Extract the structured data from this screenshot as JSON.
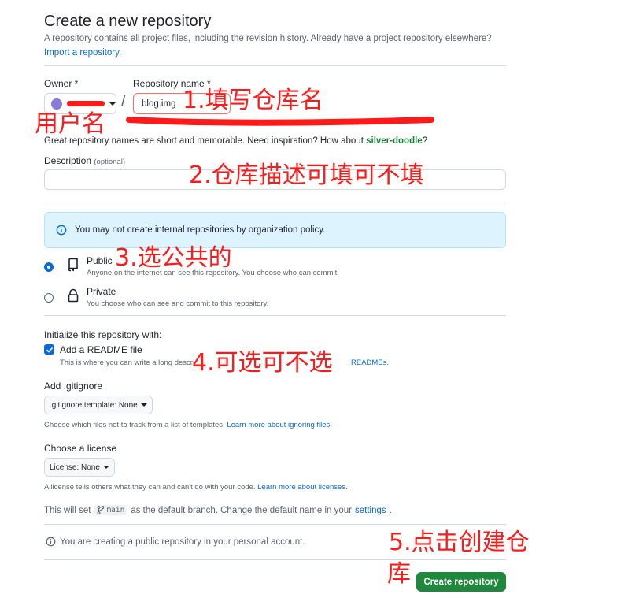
{
  "header": {
    "title": "Create a new repository",
    "description": "A repository contains all project files, including the revision history. Already have a project repository elsewhere?",
    "import_link": "Import a repository."
  },
  "owner": {
    "label": "Owner *"
  },
  "repo_name": {
    "label": "Repository name *",
    "value": "blog.img",
    "separator": "/"
  },
  "hint": {
    "prefix": "Great repository names are short and memorable. Need inspiration? How about ",
    "suggestion": "silver-doodle",
    "suffix": "?"
  },
  "description_field": {
    "label": "Description",
    "optional": "(optional)",
    "value": ""
  },
  "notice": {
    "text": "You may not create internal repositories by organization policy."
  },
  "visibility": {
    "public": {
      "label": "Public",
      "desc": "Anyone on the internet can see this repository. You choose who can commit.",
      "selected": true
    },
    "private": {
      "label": "Private",
      "desc": "You choose who can see and commit to this repository.",
      "selected": false
    }
  },
  "init": {
    "heading": "Initialize this repository with:",
    "readme_label": "Add a README file",
    "readme_checked": true,
    "readme_desc_prefix": "This is where you can write a long descri",
    "readme_desc_suffix": "READMEs."
  },
  "gitignore": {
    "heading": "Add .gitignore",
    "select": ".gitignore template: None",
    "desc": "Choose which files not to track from a list of templates.",
    "link": "Learn more about ignoring files."
  },
  "license": {
    "heading": "Choose a license",
    "select": "License: None",
    "desc": "A license tells others what they can and can't do with your code.",
    "link": "Learn more about licenses."
  },
  "branch": {
    "prefix": "This will set",
    "branch": "main",
    "middle": "as the default branch. Change the default name in your",
    "link": "settings",
    "suffix": "."
  },
  "public_notice": "You are creating a public repository in your personal account.",
  "submit": "Create repository",
  "annotations": {
    "a1": "1.填写仓库名",
    "owner": "用户名",
    "a2": "2.仓库描述可填可不填",
    "a3": "3.选公共的",
    "a4": "4.可选可不选",
    "a5_line1": "5.点击创建仓",
    "a5_line2": "库"
  },
  "colors": {
    "annotation": "#ff1a1a",
    "primary": "#1f883d",
    "link": "#0969da"
  }
}
